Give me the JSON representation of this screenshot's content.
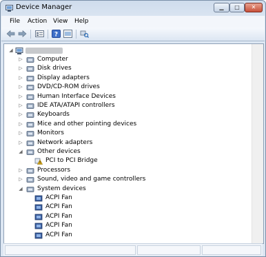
{
  "window": {
    "title": "Device Manager"
  },
  "menu": [
    "File",
    "Action",
    "View",
    "Help"
  ],
  "toolbar": {
    "icons": [
      "back-arrow-icon",
      "forward-arrow-icon",
      "properties-icon",
      "help-icon",
      "show-icon",
      "scan-hardware-icon"
    ]
  },
  "tree": {
    "root_icon": "computer-icon",
    "categories": [
      {
        "label": "Computer",
        "expanded": false
      },
      {
        "label": "Disk drives",
        "expanded": false
      },
      {
        "label": "Display adapters",
        "expanded": false
      },
      {
        "label": "DVD/CD-ROM drives",
        "expanded": false
      },
      {
        "label": "Human Interface Devices",
        "expanded": false
      },
      {
        "label": "IDE ATA/ATAPI controllers",
        "expanded": false
      },
      {
        "label": "Keyboards",
        "expanded": false
      },
      {
        "label": "Mice and other pointing devices",
        "expanded": false
      },
      {
        "label": "Monitors",
        "expanded": false
      },
      {
        "label": "Network adapters",
        "expanded": false
      },
      {
        "label": "Other devices",
        "expanded": true
      },
      {
        "label": "PCI to PCI Bridge",
        "child": true,
        "warning": true
      },
      {
        "label": "Processors",
        "expanded": false
      },
      {
        "label": "Sound, video and game controllers",
        "expanded": false
      },
      {
        "label": "System devices",
        "expanded": true
      },
      {
        "label": "ACPI Fan",
        "child": true
      },
      {
        "label": "ACPI Fan",
        "child": true
      },
      {
        "label": "ACPI Fan",
        "child": true
      },
      {
        "label": "ACPI Fan",
        "child": true
      },
      {
        "label": "ACPI Fan",
        "child": true
      }
    ]
  },
  "colors": {
    "warning": "#e3b21c",
    "title_bar": "#cfdcec",
    "close_button": "#c8513a"
  }
}
